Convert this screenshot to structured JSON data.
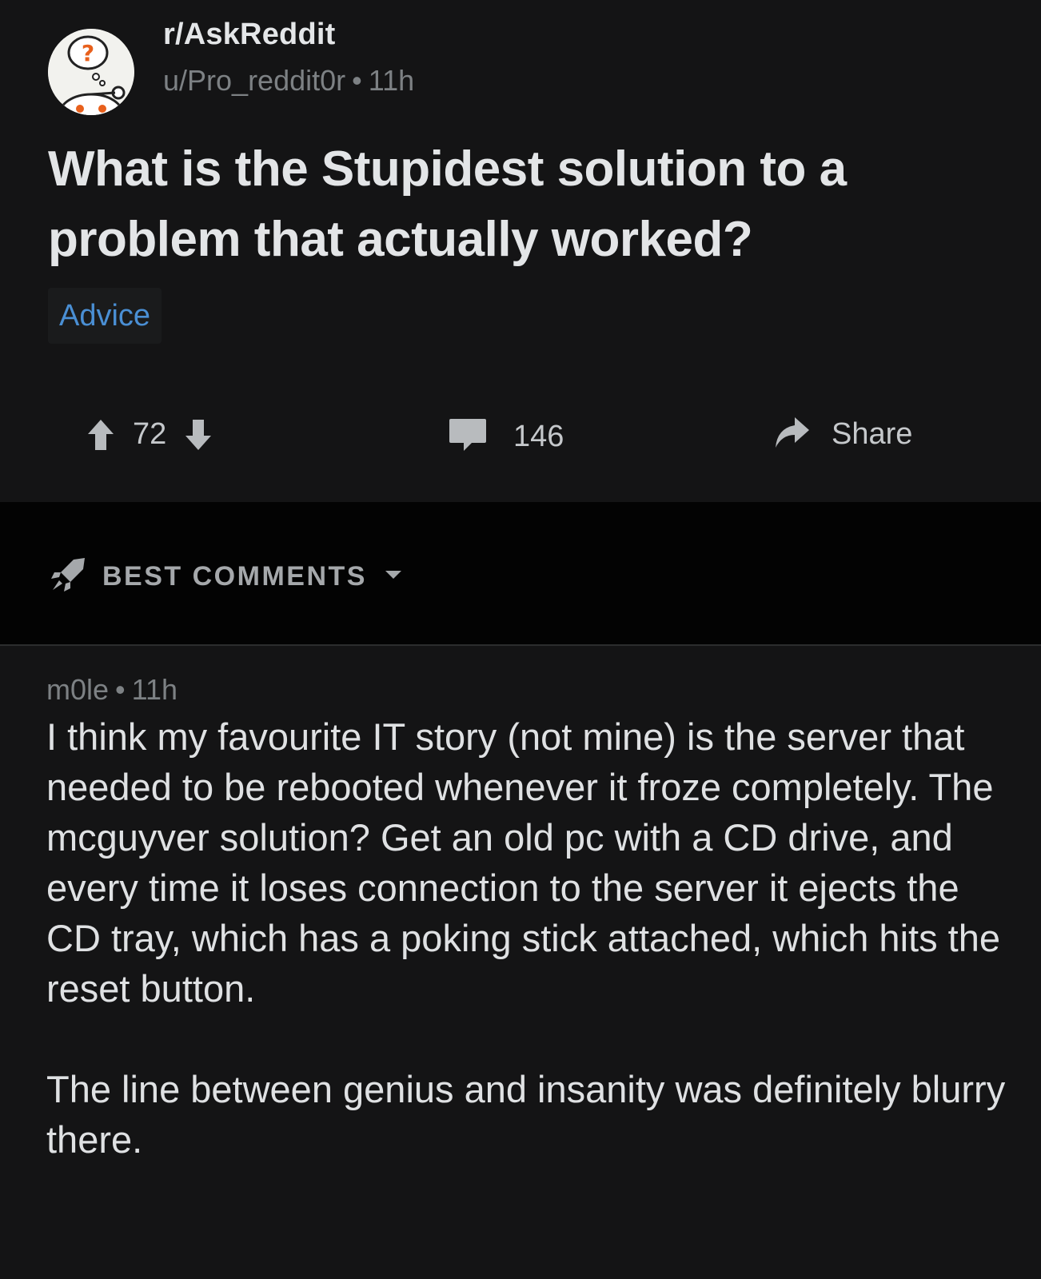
{
  "post": {
    "subreddit": "r/AskReddit",
    "author": "u/Pro_reddit0r",
    "separator": "•",
    "age": "11h",
    "title": "What is the Stupidest solution to a problem that actually worked?",
    "flair": "Advice",
    "score": "72",
    "comment_count": "146",
    "share_label": "Share"
  },
  "sort": {
    "label": "BEST COMMENTS"
  },
  "comment": {
    "author": "m0le",
    "separator": "•",
    "age": "11h",
    "paragraphs": [
      "I think my favourite IT story (not mine) is the server that needed to be rebooted whenever it froze completely. The mcguyver solution? Get an old pc with a CD drive, and every time it loses connection to the server it ejects the CD tray, which has a poking stick attached, which hits the reset button.",
      "The line between genius and insanity was definitely blurry there."
    ]
  },
  "colors": {
    "background": "#141415",
    "sort_bar": "#030303",
    "flair_text": "#4a8fd4",
    "muted_text": "#7d8184"
  },
  "icons": {
    "avatar": "askreddit-snoo-avatar",
    "upvote": "upvote-arrow-icon",
    "downvote": "downvote-arrow-icon",
    "comments": "speech-bubble-icon",
    "share": "share-arrow-icon",
    "sort": "rocket-icon",
    "dropdown": "caret-down-icon"
  }
}
